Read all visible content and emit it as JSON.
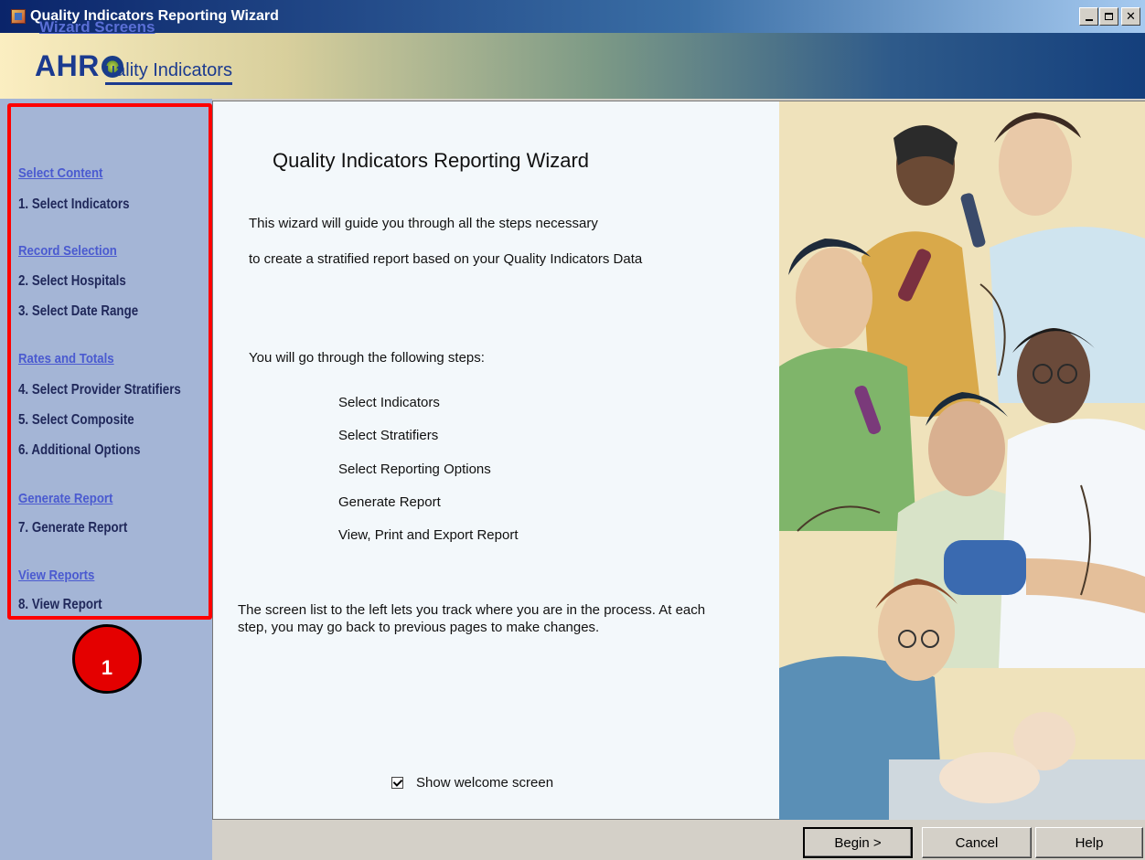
{
  "window": {
    "title": "Quality Indicators Reporting Wizard"
  },
  "banner": {
    "logo_prefix": "AHR",
    "logo_suffix": "uality Indicators"
  },
  "sidebar": {
    "header": "Wizard Screens",
    "sections": [
      {
        "label": "Select Content"
      },
      {
        "label": "Record Selection"
      },
      {
        "label": "Rates and Totals"
      },
      {
        "label": "Generate Report"
      },
      {
        "label": "View Reports"
      }
    ],
    "steps": [
      {
        "label": "1. Select Indicators"
      },
      {
        "label": "2. Select Hospitals"
      },
      {
        "label": "3. Select Date Range"
      },
      {
        "label": "4. Select Provider Stratifiers"
      },
      {
        "label": "5. Select Composite"
      },
      {
        "label": "6. Additional Options"
      },
      {
        "label": "7. Generate Report"
      },
      {
        "label": "8. View Report"
      }
    ]
  },
  "callout": {
    "number": "1",
    "color": "#e40000"
  },
  "main": {
    "title": "Quality Indicators Reporting Wizard",
    "intro_line1": "This wizard will guide you through all the steps necessary",
    "intro_line2": "to create a stratified report based on your Quality Indicators Data",
    "steps_intro": "You will go through the following steps:",
    "steps": [
      "Select Indicators",
      "Select Stratifiers",
      "Select Reporting Options",
      "Generate Report",
      "View, Print and Export Report"
    ],
    "help_text": "The screen list to the left lets you track where you are in the process.  At each step, you may go back to previous pages to make changes.",
    "show_welcome_label": "Show welcome screen",
    "show_welcome_checked": true
  },
  "buttons": {
    "begin": "Begin >",
    "cancel": "Cancel",
    "help": "Help"
  },
  "colors": {
    "sidebar_bg": "#a4b5d6",
    "section_link": "#4a5ad0",
    "step_text": "#20285a",
    "highlight_outline": "#ff0000"
  }
}
